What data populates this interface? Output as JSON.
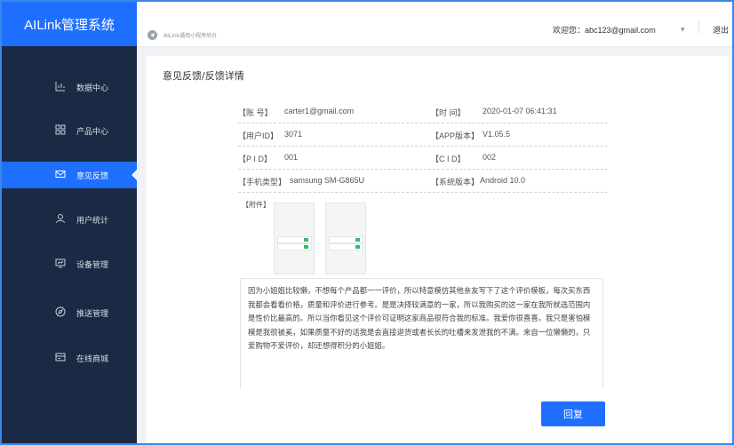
{
  "app": {
    "title": "AILink管理系统"
  },
  "sidebar": {
    "items": [
      {
        "label": "数据中心",
        "icon": "bar-chart-icon"
      },
      {
        "label": "产品中心",
        "icon": "grid-icon"
      },
      {
        "label": "意见反馈",
        "icon": "mail-icon",
        "active": true
      },
      {
        "label": "用户统计",
        "icon": "user-icon"
      },
      {
        "label": "设备管理",
        "icon": "device-icon"
      },
      {
        "label": "推送管理",
        "icon": "compass-icon"
      },
      {
        "label": "在线商城",
        "icon": "store-icon"
      }
    ]
  },
  "header": {
    "breadcrumb": "AILink通用小程序后台",
    "welcome_label": "欢迎您：",
    "user_email": "abc123@gmail.com",
    "logout_label": "退出"
  },
  "page": {
    "title": "意见反馈/反馈详情",
    "info": {
      "account_label": "【账    号】",
      "account_value": "carter1@gmail.com",
      "time_label": "【时      间】",
      "time_value": "2020-01-07 06:41:31",
      "uid_label": "【用户ID】",
      "uid_value": "3071",
      "app_version_label": "【APP版本】",
      "app_version_value": "V1.05.5",
      "pid_label": "【P I D】",
      "pid_value": "001",
      "cid_label": "【C I D】",
      "cid_value": "002",
      "phone_model_label": "【手机类型】",
      "phone_model_value": "samsung SM-G865U",
      "os_version_label": "【系统版本】",
      "os_version_value": "Android 10.0",
      "attachment_label": "【附件】"
    },
    "feedback_text": "因为小姐姐比较懒，不想每个产品都一一评价，所以特意模仿其他亲友写下了这个评价模板，每次买东西我都会看看价格，质量和评价进行参考。是是决择较满意的一家，所以我购买的这一家在我所就选范围内是性价比最高的。所以当你看见这个评价可证明这家商品很符合我的标准。我爱你很喜喜。我只是害怕模模是我很被奚，如果质量不好的话我是会直接退货或者长长的吐槽来发泄我的不满。来自一位懒懒的，只爱购物不爱评价，却还想得积分的小姐姐。",
    "reply_label": "回复"
  },
  "colors": {
    "brand": "#1f6fff",
    "sidebar_bg": "#1b2a44",
    "page_bg": "#f0f2f5",
    "frame_border": "#3a87ea",
    "toggle_green": "#2dbf6a"
  }
}
